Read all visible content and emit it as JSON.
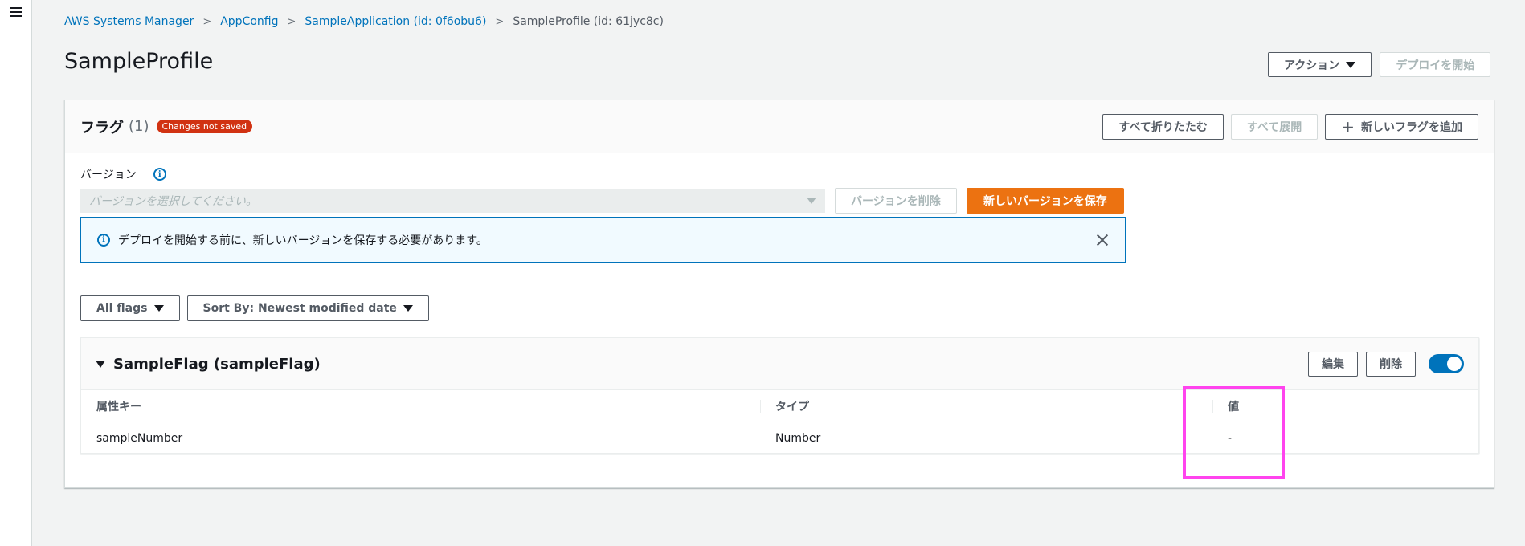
{
  "breadcrumb": {
    "items": [
      "AWS Systems Manager",
      "AppConfig",
      "SampleApplication (id: 0f6obu6)"
    ],
    "current": "SampleProfile (id: 61jyc8c)",
    "separator": ">"
  },
  "page": {
    "title": "SampleProfile"
  },
  "header_actions": {
    "actions_label": "アクション",
    "start_deploy_label": "デプロイを開始"
  },
  "flags_panel": {
    "title": "フラグ",
    "count": "(1)",
    "badge": "Changes not saved",
    "collapse_all": "すべて折りたたむ",
    "expand_all": "すべて展開",
    "add_flag": "新しいフラグを追加",
    "add_icon": "+"
  },
  "version": {
    "label": "バージョン",
    "info_icon": "i",
    "placeholder": "バージョンを選択してください。",
    "delete_label": "バージョンを削除",
    "save_label": "新しいバージョンを保存"
  },
  "alert": {
    "info_icon": "i",
    "text": "デプロイを開始する前に、新しいバージョンを保存する必要があります。"
  },
  "filters": {
    "all_flags": "All flags",
    "sort_by": "Sort By: Newest modified date"
  },
  "flag": {
    "title": "SampleFlag (sampleFlag)",
    "edit_label": "編集",
    "delete_label": "削除",
    "enabled": true,
    "table": {
      "headers": [
        "属性キー",
        "タイプ",
        "値"
      ],
      "rows": [
        [
          "sampleNumber",
          "Number",
          "-"
        ]
      ]
    }
  },
  "colors": {
    "primary": "#ec7211",
    "link": "#0073bb",
    "badge": "#d13212",
    "highlight": "#ff44ee"
  }
}
